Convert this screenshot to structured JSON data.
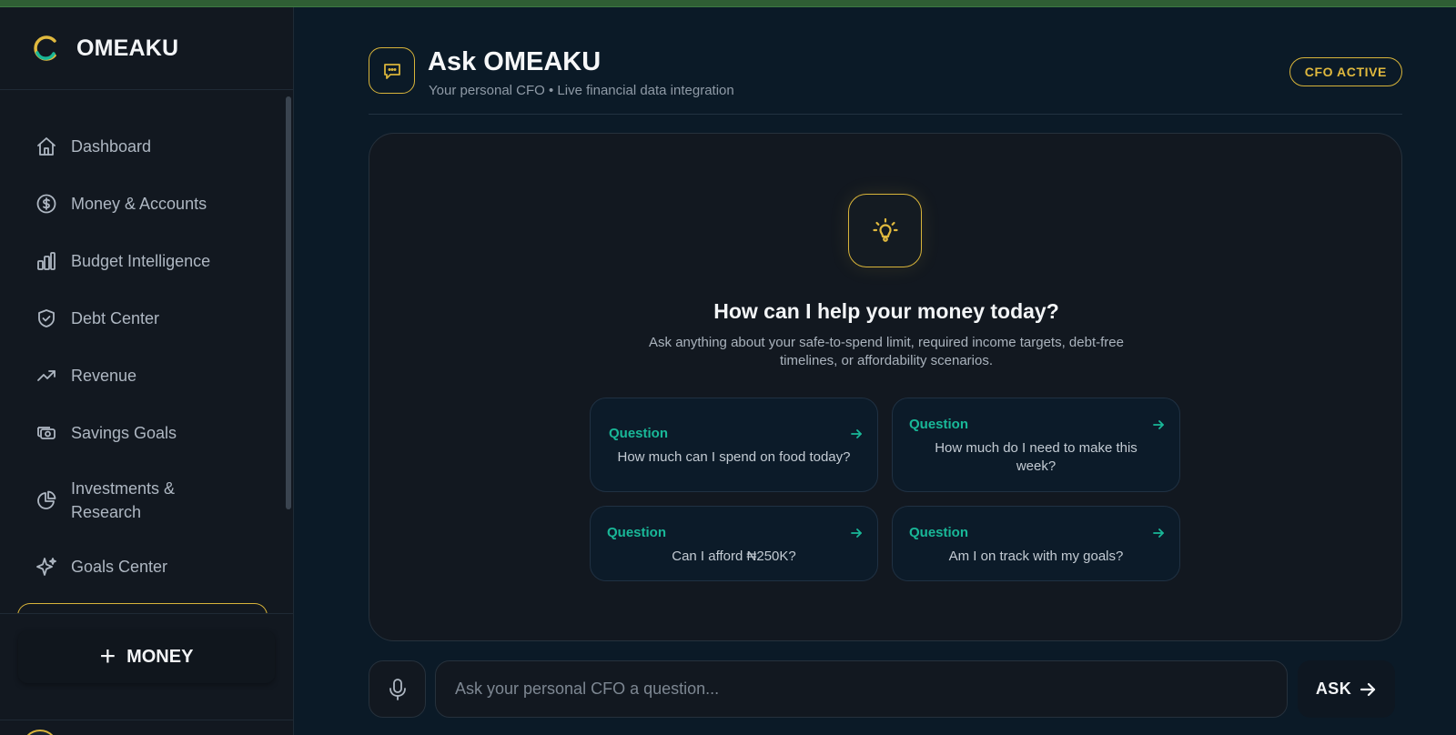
{
  "brand": {
    "name": "OMEAKU"
  },
  "sidebar": {
    "items": [
      {
        "label": "Dashboard",
        "icon": "home-icon"
      },
      {
        "label": "Money & Accounts",
        "icon": "dollar-circle-icon"
      },
      {
        "label": "Budget Intelligence",
        "icon": "bar-chart-icon"
      },
      {
        "label": "Debt Center",
        "icon": "shield-check-icon"
      },
      {
        "label": "Revenue",
        "icon": "trending-up-icon"
      },
      {
        "label": "Savings Goals",
        "icon": "cash-icon"
      },
      {
        "label": "Investments & Research",
        "icon": "pie-chart-icon"
      },
      {
        "label": "Goals Center",
        "icon": "sparkles-icon"
      }
    ],
    "money_button": {
      "label": "MONEY",
      "icon": "plus-icon"
    }
  },
  "header": {
    "title": "Ask OMEAKU",
    "subtitle": "Your personal CFO • Live financial data integration",
    "badge": "CFO ACTIVE",
    "icon": "chat-bubble-icon"
  },
  "welcome": {
    "icon": "lightbulb-icon",
    "title": "How can I help your money today?",
    "subtitle": "Ask anything about your safe-to-spend limit, required income targets, debt-free timelines, or affordability scenarios."
  },
  "questions": [
    {
      "tag": "Question",
      "text": "How much can I spend on food today?"
    },
    {
      "tag": "Question",
      "text": "How much do I need to make this week?"
    },
    {
      "tag": "Question",
      "text": "Can I afford ₦250K?"
    },
    {
      "tag": "Question",
      "text": "Am I on track with my goals?"
    }
  ],
  "composer": {
    "placeholder": "Ask your personal CFO a question...",
    "ask_label": "ASK",
    "mic_icon": "microphone-icon"
  },
  "colors": {
    "accent_gold": "#d8b43a",
    "accent_teal": "#19b898",
    "background": "#0b1a27",
    "panel": "#121820"
  }
}
